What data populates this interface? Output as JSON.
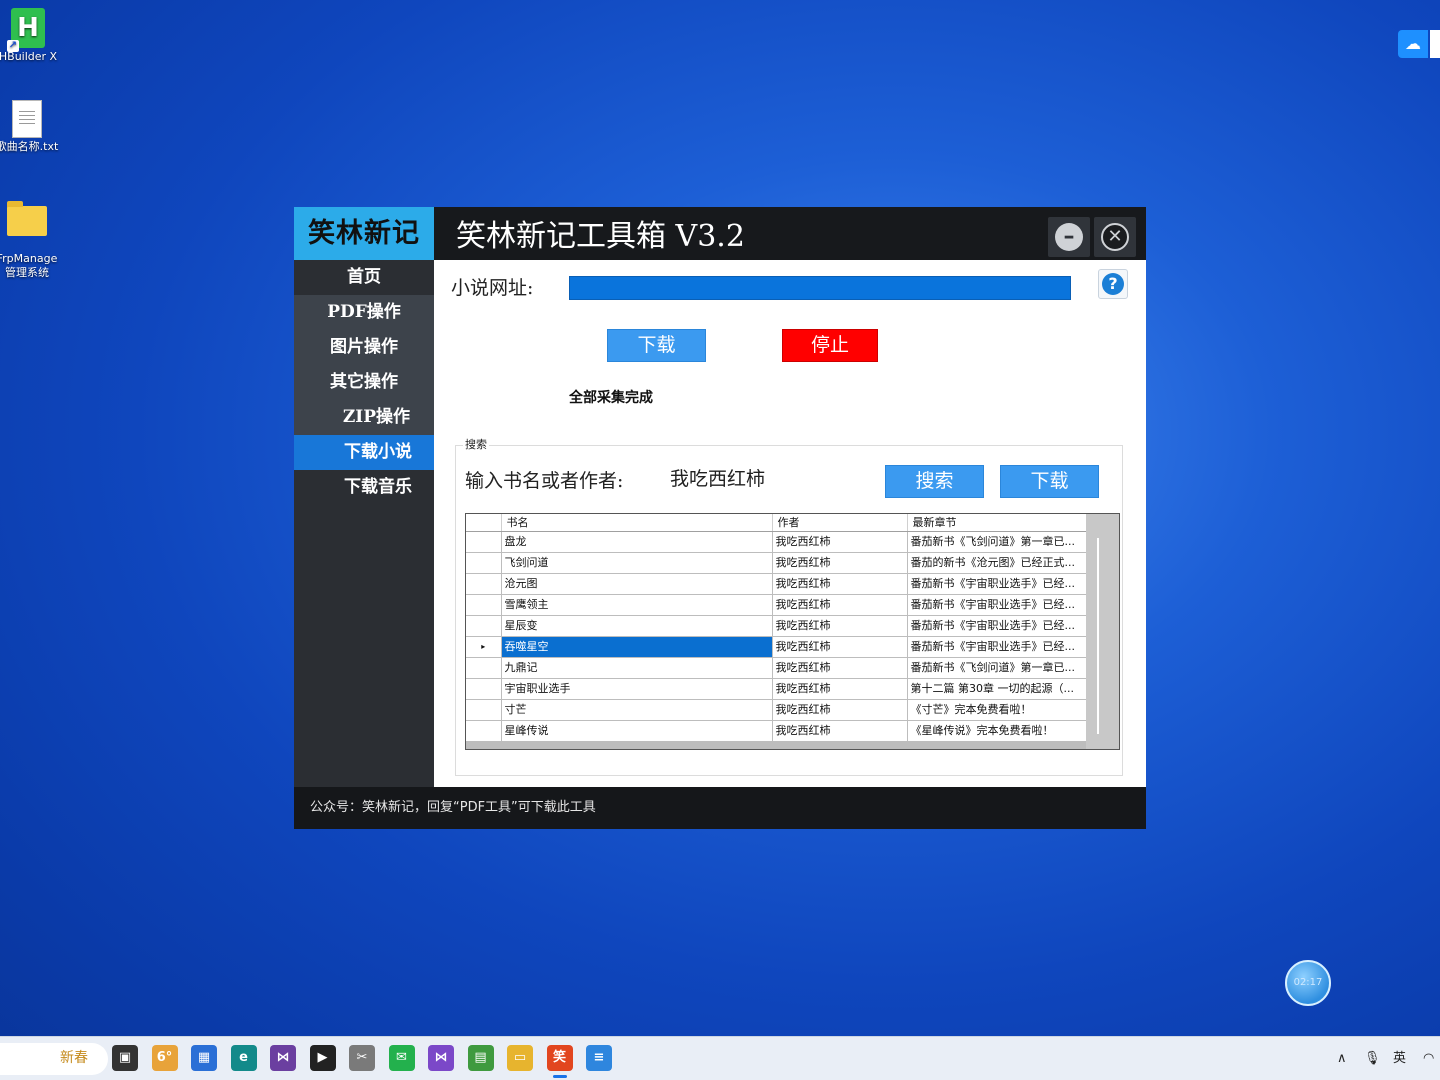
{
  "desktop": {
    "icons": [
      {
        "label": "HBuilder X",
        "icon": "hbuilder-icon"
      },
      {
        "label": "歌曲名称.txt",
        "icon": "text-file-icon"
      },
      {
        "label": "FrpManage\n管理系统",
        "icon": "folder-icon"
      }
    ],
    "clock_bubble": "02:17"
  },
  "window": {
    "logo": "笑林新记",
    "title": "笑林新记工具箱 V3.2",
    "minimize_glyph": "–",
    "close_glyph": "✕",
    "nav": [
      {
        "label": "首页"
      },
      {
        "label": "PDF操作"
      },
      {
        "label": "图片操作"
      },
      {
        "label": "其它操作"
      },
      {
        "label": "ZIP操作"
      },
      {
        "label": "下载小说",
        "active": true
      },
      {
        "label": "下载音乐"
      }
    ],
    "url_label": "小说网址:",
    "url_value": "",
    "help_glyph": "?",
    "download_label": "下载",
    "stop_label": "停止",
    "status": "全部采集完成",
    "search_group": {
      "label": "搜索",
      "input_label": "输入书名或者作者:",
      "input_value": "我吃西红柿",
      "search_button": "搜索",
      "download_button": "下载"
    },
    "grid": {
      "columns": [
        "书名",
        "作者",
        "最新章节"
      ],
      "rows": [
        [
          "盘龙",
          "我吃西红柿",
          "番茄新书《飞剑问道》第一章已..."
        ],
        [
          "飞剑问道",
          "我吃西红柿",
          "番茄的新书《沧元图》已经正式..."
        ],
        [
          "沧元图",
          "我吃西红柿",
          "番茄新书《宇宙职业选手》已经..."
        ],
        [
          "雪鹰领主",
          "我吃西红柿",
          "番茄新书《宇宙职业选手》已经..."
        ],
        [
          "星辰变",
          "我吃西红柿",
          "番茄新书《宇宙职业选手》已经..."
        ],
        [
          "吞噬星空",
          "我吃西红柿",
          "番茄新书《宇宙职业选手》已经..."
        ],
        [
          "九鼎记",
          "我吃西红柿",
          "番茄新书《飞剑问道》第一章已..."
        ],
        [
          "宇宙职业选手",
          "我吃西红柿",
          "第十二篇 第30章 一切的起源（..."
        ],
        [
          "寸芒",
          "我吃西红柿",
          "《寸芒》完本免费看啦！"
        ],
        [
          "星峰传说",
          "我吃西红柿",
          "《星峰传说》完本免费看啦！"
        ]
      ],
      "selected_row": 5,
      "row_marker": "▸"
    },
    "footer": "公众号：笑林新记，回复“PDF工具”可下载此工具"
  },
  "taskbar": {
    "search_text": "新春",
    "apps": [
      {
        "icon": "task-view-icon",
        "color": "#333333",
        "glyph": "▣"
      },
      {
        "icon": "weather-icon",
        "color": "#e8a33a",
        "glyph": "6°"
      },
      {
        "icon": "store-icon",
        "color": "#2a6fd6",
        "glyph": "▦"
      },
      {
        "icon": "edge-icon",
        "color": "#138a8a",
        "glyph": "e"
      },
      {
        "icon": "visual-studio-icon",
        "color": "#6b3fa0",
        "glyph": "⋈"
      },
      {
        "icon": "media-player-icon",
        "color": "#222222",
        "glyph": "▶"
      },
      {
        "icon": "tools-icon",
        "color": "#7a7a7a",
        "glyph": "✂"
      },
      {
        "icon": "wechat-icon",
        "color": "#23b14d",
        "glyph": "✉"
      },
      {
        "icon": "visual-studio-2-icon",
        "color": "#7b48c8",
        "glyph": "⋈"
      },
      {
        "icon": "chart-app-icon",
        "color": "#3f9a3f",
        "glyph": "▤"
      },
      {
        "icon": "file-explorer-icon",
        "color": "#e7b42e",
        "glyph": "▭"
      },
      {
        "icon": "toolbox-app-icon",
        "color": "#e2461f",
        "glyph": "笑",
        "active": true
      },
      {
        "icon": "notepad-icon",
        "color": "#2e86de",
        "glyph": "≡"
      }
    ],
    "tray": {
      "chevron": "∧",
      "mic": "🎙",
      "ime": "英",
      "wifi": "◠"
    }
  }
}
